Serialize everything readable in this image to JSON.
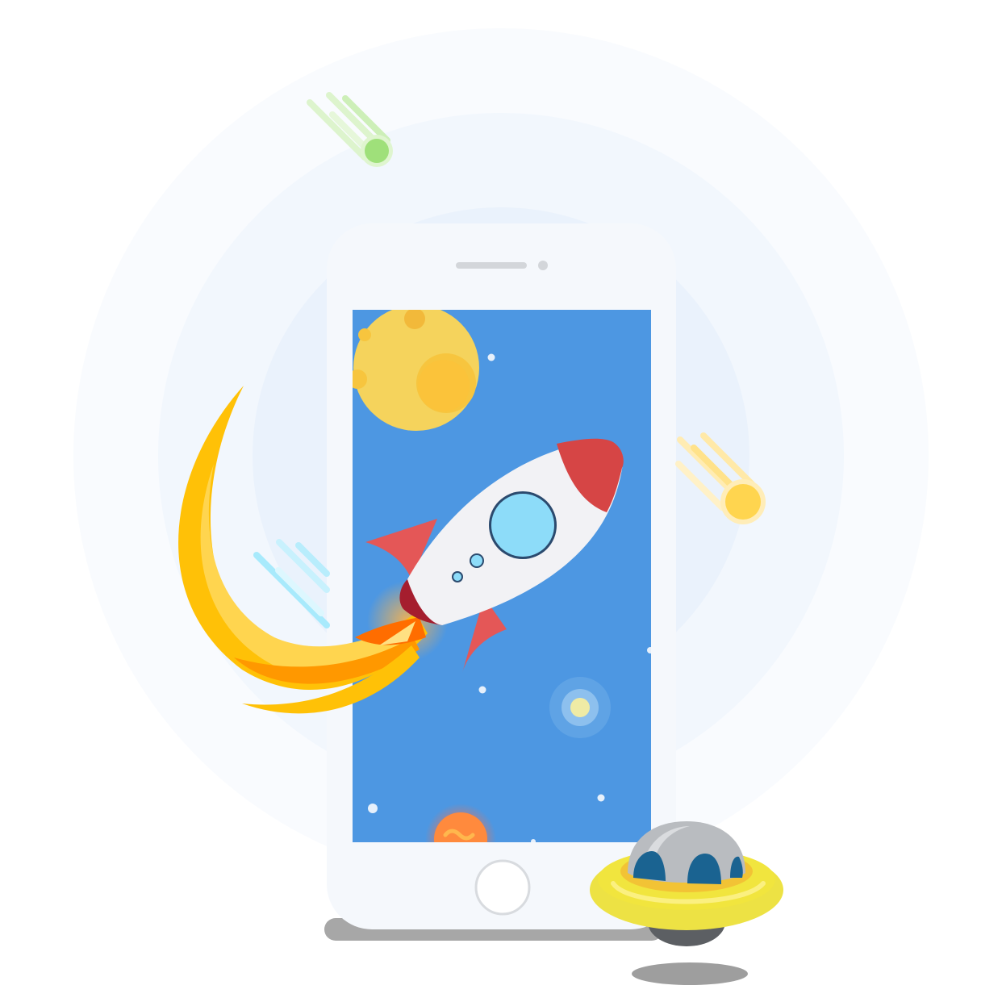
{
  "illustration": {
    "subject": "rocket-launching-from-phone",
    "icons": [
      "background-halo",
      "phone-device",
      "phone-speaker",
      "phone-camera",
      "phone-screen",
      "moon-icon",
      "rocket-icon",
      "rocket-flame",
      "comet-green-icon",
      "comet-yellow-icon",
      "comet-blue-icon",
      "ufo-icon",
      "home-button",
      "planet-icon",
      "glowing-star-icon"
    ],
    "colors": {
      "screen": "#4D97E2",
      "phone_body": "#F5F8FC",
      "moon": "#F5D35C",
      "rocket_body": "#F2F2F5",
      "rocket_nose": "#D64545",
      "rocket_window": "#8DDCF9",
      "flame_outer": "#FFC107",
      "flame_inner": "#FF7A00",
      "comet_green": "#9FE07A",
      "comet_yellow": "#FFD54F",
      "comet_blue": "#9FE6FA",
      "ufo_disc": "#F1E53E",
      "ufo_dome": "#B9BCC0",
      "ufo_window": "#1A6391"
    }
  }
}
